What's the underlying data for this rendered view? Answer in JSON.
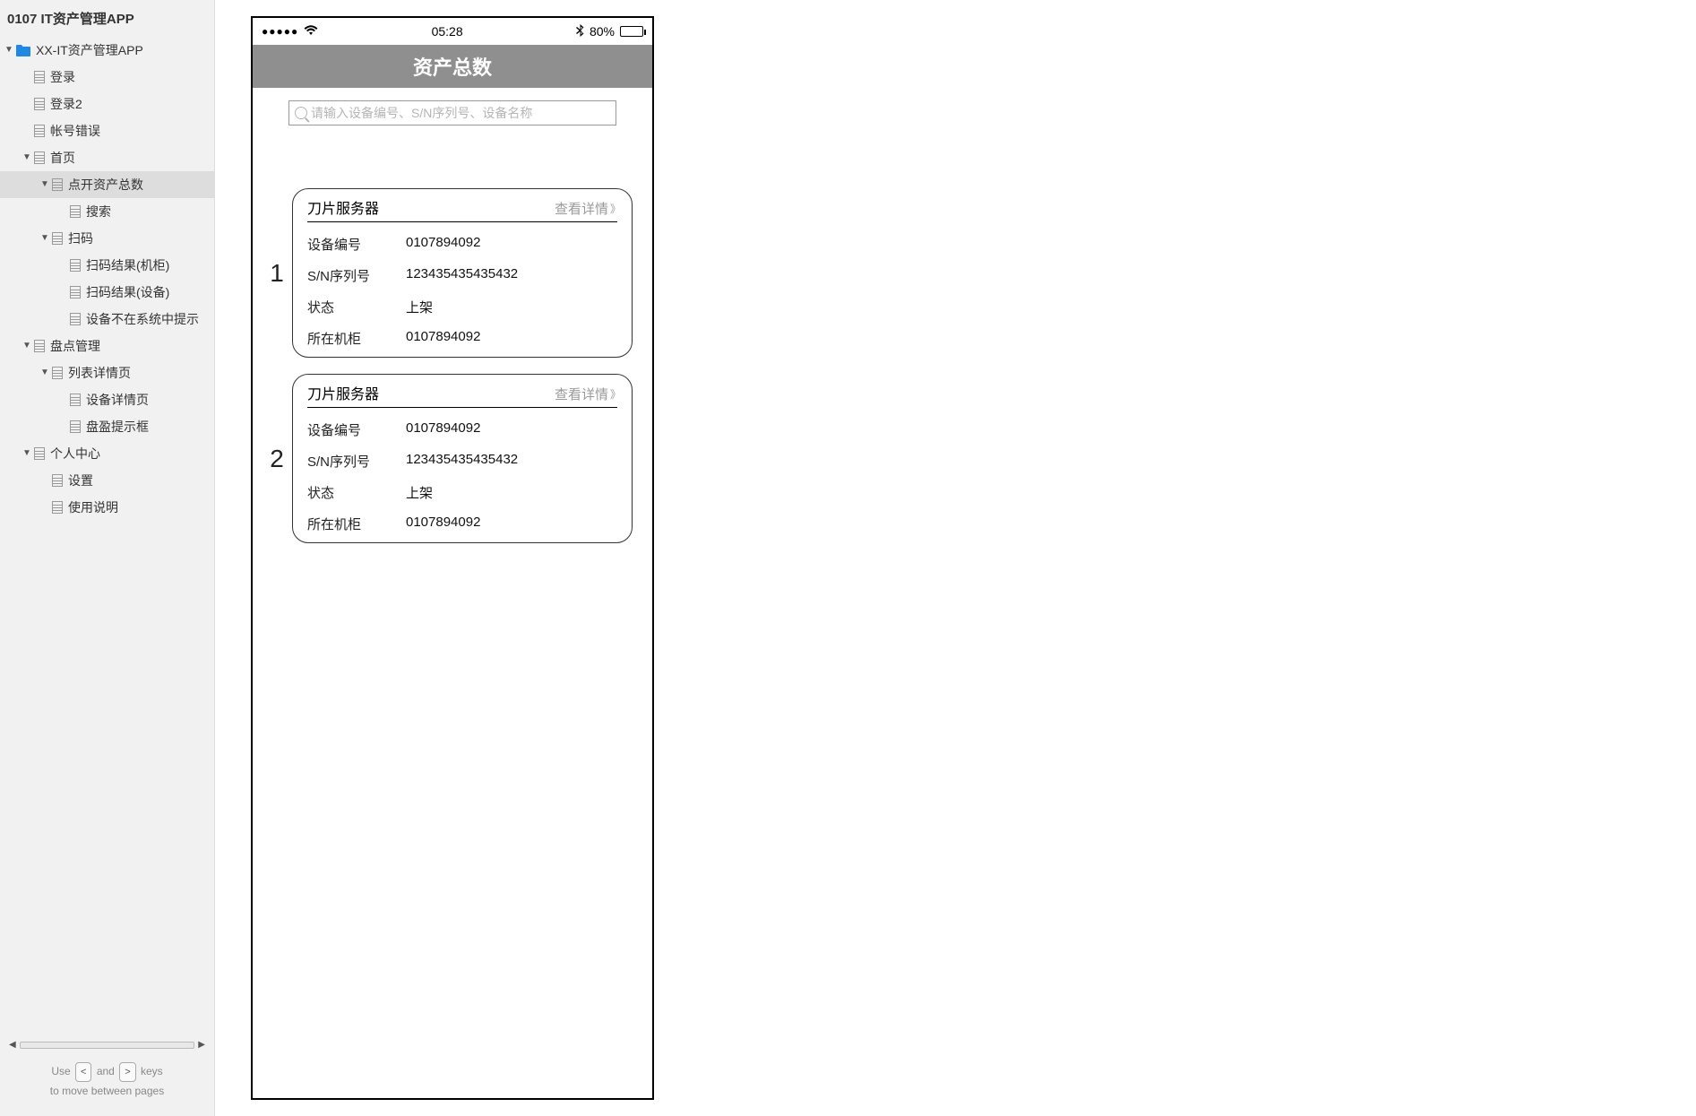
{
  "sidebar": {
    "title": "0107 IT资产管理APP",
    "tree": [
      {
        "level": 0,
        "caret": "▼",
        "icon": "folder",
        "label": "XX-IT资产管理APP"
      },
      {
        "level": 1,
        "caret": "",
        "icon": "page",
        "label": "登录"
      },
      {
        "level": 1,
        "caret": "",
        "icon": "page",
        "label": "登录2"
      },
      {
        "level": 1,
        "caret": "",
        "icon": "page",
        "label": "帐号错误"
      },
      {
        "level": 1,
        "caret": "▼",
        "icon": "page",
        "label": "首页"
      },
      {
        "level": 2,
        "caret": "▼",
        "icon": "page",
        "label": "点开资产总数",
        "selected": true
      },
      {
        "level": 3,
        "caret": "",
        "icon": "page",
        "label": "搜索"
      },
      {
        "level": 2,
        "caret": "▼",
        "icon": "page",
        "label": "扫码"
      },
      {
        "level": 3,
        "caret": "",
        "icon": "page",
        "label": "扫码结果(机柜)"
      },
      {
        "level": 3,
        "caret": "",
        "icon": "page",
        "label": "扫码结果(设备)"
      },
      {
        "level": 3,
        "caret": "",
        "icon": "page",
        "label": "设备不在系统中提示"
      },
      {
        "level": 1,
        "caret": "▼",
        "icon": "page",
        "label": "盘点管理"
      },
      {
        "level": 2,
        "caret": "▼",
        "icon": "page",
        "label": "列表详情页"
      },
      {
        "level": 3,
        "caret": "",
        "icon": "page",
        "label": "设备详情页"
      },
      {
        "level": 3,
        "caret": "",
        "icon": "page",
        "label": "盘盈提示框"
      },
      {
        "level": 1,
        "caret": "▼",
        "icon": "page",
        "label": "个人中心"
      },
      {
        "level": 2,
        "caret": "",
        "icon": "page",
        "label": "设置"
      },
      {
        "level": 2,
        "caret": "",
        "icon": "page",
        "label": "使用说明"
      }
    ],
    "hint_use": "Use",
    "hint_and": "and",
    "hint_keys": "keys",
    "hint_move": "to move between pages",
    "key_left": "<",
    "key_right": ">"
  },
  "phone": {
    "status": {
      "time": "05:28",
      "battery_pct": "80%"
    },
    "header_title": "资产总数",
    "search_placeholder": "请输入设备编号、S/N序列号、设备名称",
    "fields": {
      "device_no": "设备编号",
      "sn": "S/N序列号",
      "state": "状态",
      "cabinet": "所在机柜"
    },
    "detail_link": "查看详情",
    "cards": [
      {
        "index": "1",
        "title": "刀片服务器",
        "device_no": "0107894092",
        "sn": "123435435435432",
        "state": "上架",
        "cabinet": "0107894092"
      },
      {
        "index": "2",
        "title": "刀片服务器",
        "device_no": "0107894092",
        "sn": "123435435435432",
        "state": "上架",
        "cabinet": "0107894092"
      }
    ]
  }
}
